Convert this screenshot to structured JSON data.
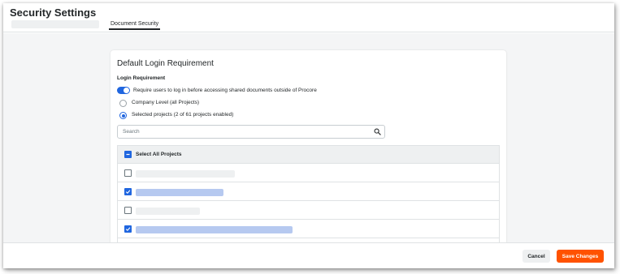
{
  "header": {
    "title": "Security Settings"
  },
  "tabs": [
    {
      "label": "Document Security",
      "active": true
    }
  ],
  "card": {
    "title": "Default Login Requirement",
    "section_label": "Login Requirement",
    "toggle": {
      "label": "Require users to log in before accessing shared documents outside of Procore",
      "on": true
    },
    "options": [
      {
        "label": "Company Level (all Projects)",
        "selected": false
      },
      {
        "label": "Selected projects (2 of 61 projects enabled)",
        "selected": true
      }
    ]
  },
  "search": {
    "placeholder": "Search",
    "icon": "search-icon"
  },
  "table": {
    "header": {
      "label": "Select All Projects",
      "state": "indeterminate"
    },
    "rows": [
      {
        "checked": false
      },
      {
        "checked": true
      },
      {
        "checked": false
      },
      {
        "checked": true
      },
      {
        "checked": false
      }
    ]
  },
  "footer": {
    "cancel_label": "Cancel",
    "save_label": "Save Changes"
  },
  "colors": {
    "accent": "#2066df",
    "primary_button": "#ff5200",
    "background": "#f4f5f6"
  }
}
